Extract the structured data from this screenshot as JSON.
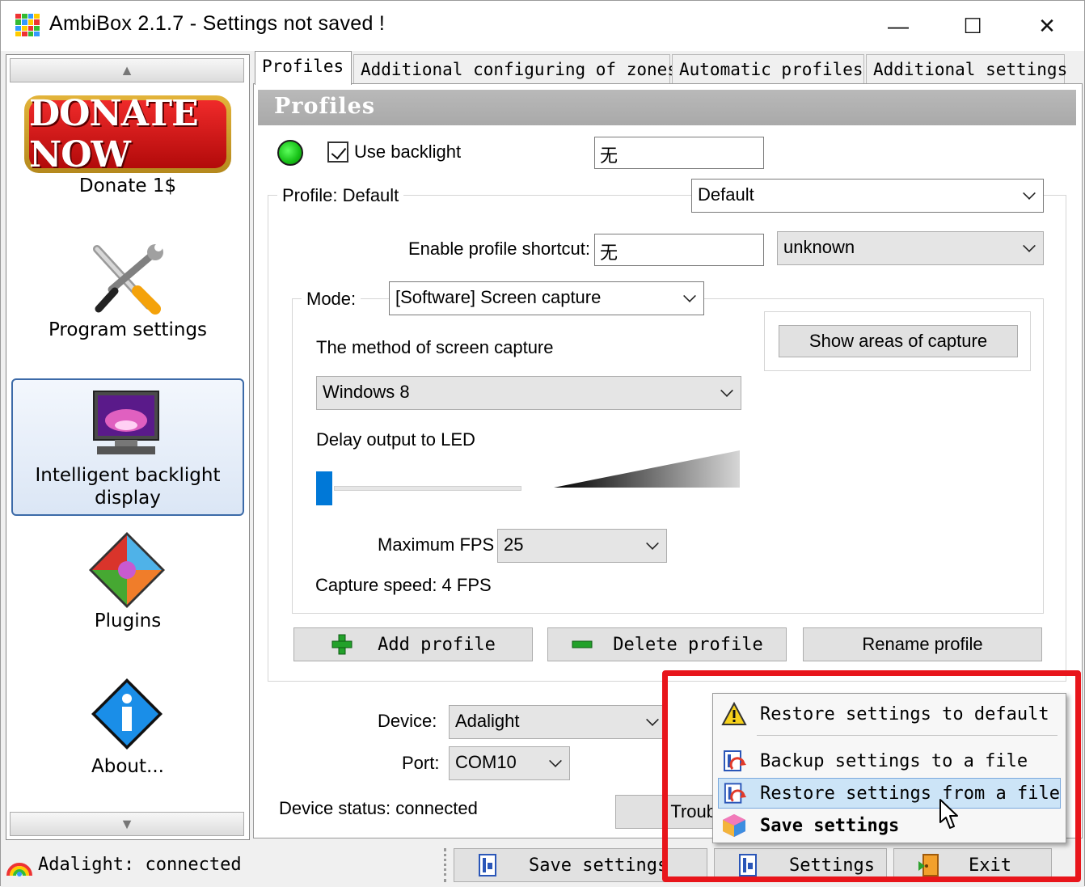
{
  "window": {
    "title": "AmbiBox 2.1.7  - Settings not saved !",
    "minimize_glyph": "—",
    "maximize_glyph": "☐",
    "close_glyph": "✕"
  },
  "sidebar": {
    "donate_badge": "DONATE NOW",
    "donate_label": "Donate 1$",
    "items": [
      {
        "label": "Program settings",
        "icon": "tools-icon"
      },
      {
        "label": "Intelligent backlight display",
        "icon": "monitor-icon",
        "selected": true
      },
      {
        "label": "Plugins",
        "icon": "puzzle-icon"
      },
      {
        "label": "About...",
        "icon": "info-icon"
      }
    ],
    "scroll_up": "▲",
    "scroll_down": "▼"
  },
  "tabs": [
    {
      "label": "Profiles",
      "active": true
    },
    {
      "label": "Additional configuring of zones"
    },
    {
      "label": "Automatic profiles"
    },
    {
      "label": "Additional settings"
    }
  ],
  "panel": {
    "header": "Profiles",
    "use_backlight": {
      "label": "Use backlight",
      "checked": true
    },
    "backlight_hotkey_value": "无",
    "profile_group_label": "Profile: Default",
    "profile_select": "Default",
    "shortcut_label": "Enable profile shortcut:",
    "shortcut_value": "无",
    "shortcut_select": "unknown",
    "mode_label": "Mode:",
    "mode_select": "[Software] Screen capture",
    "show_areas_button": "Show areas of capture",
    "capture_method_label": "The method of screen capture",
    "capture_method_select": "Windows 8",
    "delay_label": "Delay output to LED",
    "delay_value": 0,
    "max_fps_label": "Maximum FPS",
    "max_fps_select": "25",
    "capture_speed": "Capture speed: 4 FPS",
    "add_profile": "Add profile",
    "delete_profile": "Delete profile",
    "rename_profile": "Rename profile",
    "device_label": "Device:",
    "device_select": "Adalight",
    "port_label": "Port:",
    "port_select": "COM10",
    "device_status": "Device status: connected",
    "troubleshoot_button": "Troub"
  },
  "statusbar": {
    "status_text": "Adalight: connected",
    "save_settings": "Save settings",
    "settings": "Settings",
    "exit": "Exit"
  },
  "context_menu": {
    "items": [
      {
        "label": "Restore settings to default",
        "icon": "warning-icon"
      },
      {
        "label": "Backup settings to a file",
        "icon": "backup-icon"
      },
      {
        "label": "Restore settings from a file",
        "icon": "restore-file-icon",
        "highlighted": true
      },
      {
        "label": "Save settings",
        "icon": "save-cube-icon",
        "bold": true
      }
    ]
  },
  "colors": {
    "accent": "#0078d7",
    "highlight_box": "#e8151b",
    "menu_highlight": "#cce4f7",
    "panel_header": "#b0b0b0",
    "donate_red": "#d21515",
    "donate_gold": "#d4a22a"
  }
}
